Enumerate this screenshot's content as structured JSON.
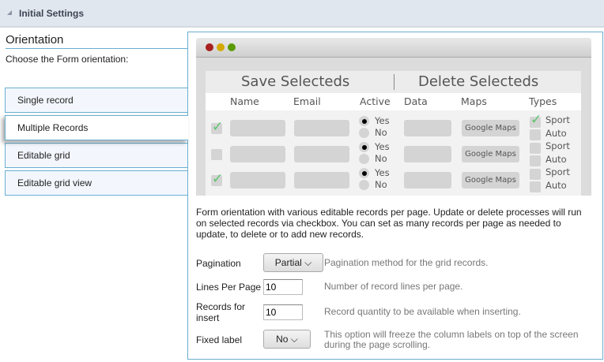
{
  "header": {
    "title": "Initial Settings"
  },
  "orientation": {
    "title": "Orientation",
    "prompt": "Choose the Form orientation:",
    "options": [
      {
        "label": "Single record"
      },
      {
        "label": "Multiple Records",
        "selected": true
      },
      {
        "label": "Editable grid"
      },
      {
        "label": "Editable grid view"
      }
    ]
  },
  "preview": {
    "save": "Save Selecteds",
    "delete": "Delete Selecteds",
    "columns": [
      "Name",
      "Email",
      "Active",
      "Data",
      "Maps",
      "Types"
    ],
    "yes": "Yes",
    "no": "No",
    "maps_button": "Google Maps",
    "sport": "Sport",
    "auto": "Auto",
    "rows": [
      {
        "checked": true,
        "sport": true
      },
      {
        "checked": false,
        "sport": false
      },
      {
        "checked": true,
        "sport": false
      }
    ]
  },
  "description": "Form orientation with various editable records per page. Update or delete processes will run on selected records via checkbox. You can set as many records per page as needed to update, to delete or to add new records.",
  "settings": {
    "pagination": {
      "label": "Pagination",
      "value": "Partial",
      "hint": "Pagination method for the grid records."
    },
    "lines": {
      "label": "Lines Per Page",
      "value": "10",
      "hint": "Number of record lines per page."
    },
    "records": {
      "label": "Records for insert",
      "value": "10",
      "hint": "Record quantity to be available when inserting."
    },
    "fixed": {
      "label": "Fixed label",
      "value": "No",
      "hint": "This option will freeze the column labels on top of the screen during the page scrolling."
    }
  },
  "colors": {
    "accent": "#6aaed0",
    "header_bg": "#e1e7ef"
  }
}
